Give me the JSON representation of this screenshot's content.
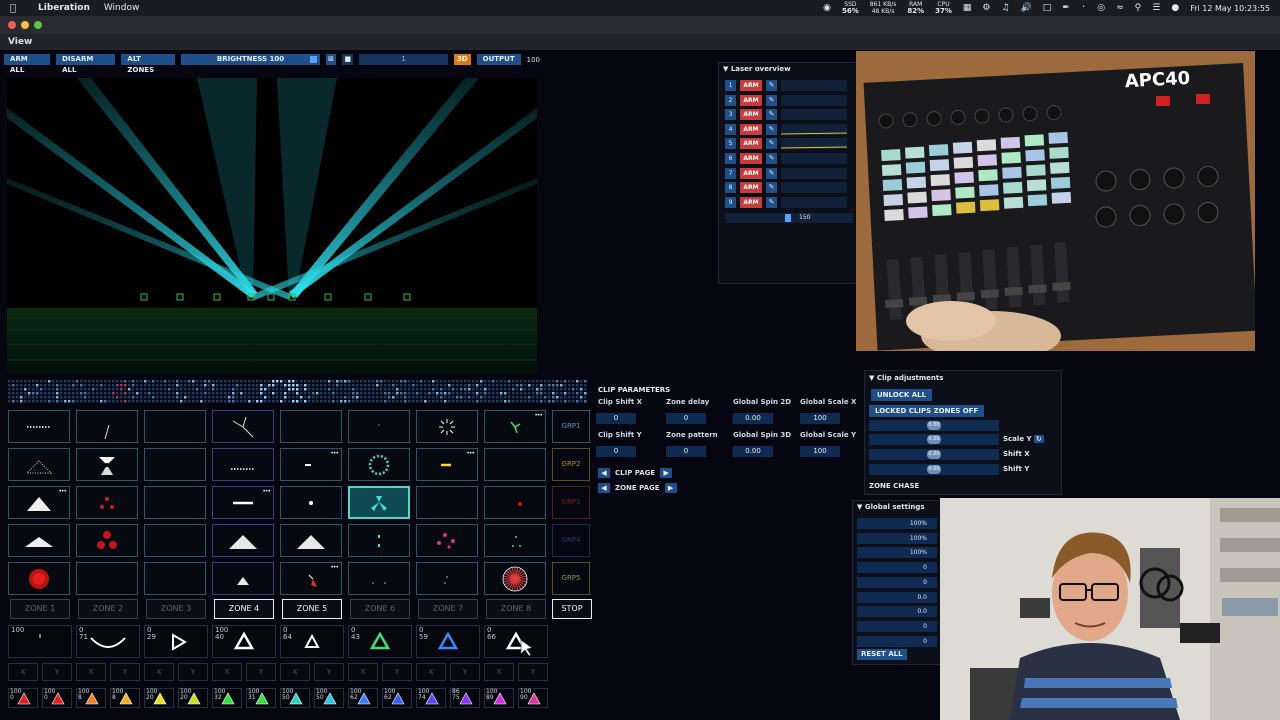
{
  "menubar": {
    "app": "Liberation",
    "menu_window": "Window",
    "disk_label": "SSD",
    "disk_value": "56%",
    "net_up": "861 KB/s",
    "net_down": "48 KB/s",
    "ram_label": "RAM",
    "ram_value": "82%",
    "cpu_label": "CPU",
    "cpu_value": "37%",
    "datetime": "Fri 12 May  10:23:55"
  },
  "window": {
    "view_label": "View"
  },
  "toolbar": {
    "arm_all": "ARM ALL",
    "disarm_all": "DISARM ALL",
    "alt_zones": "ALT ZONES",
    "brightness": "BRIGHTNESS 100",
    "zoom_value": "1",
    "btn_3d": "3D",
    "output": "OUTPUT",
    "output_value": "100"
  },
  "clip_grid": {
    "groups": [
      "GRP1",
      "GRP2",
      "GRP3",
      "GRP4",
      "GRP5"
    ],
    "zones": [
      "ZONE 1",
      "ZONE 2",
      "ZONE 3",
      "ZONE 4",
      "ZONE 5",
      "ZONE 6",
      "ZONE 7",
      "ZONE 8"
    ],
    "stop": "STOP"
  },
  "fx_row": {
    "values": [
      [
        "100",
        ""
      ],
      [
        "0",
        "71"
      ],
      [
        "0",
        "29"
      ],
      [
        "100",
        "40"
      ],
      [
        "0",
        "64"
      ],
      [
        "0",
        "43"
      ],
      [
        "0",
        "59"
      ],
      [
        "0",
        "66"
      ]
    ]
  },
  "xy_labels": [
    "X",
    "Y"
  ],
  "mini_row": {
    "values": [
      [
        "100",
        "0"
      ],
      [
        "100",
        "0"
      ],
      [
        "100",
        "8"
      ],
      [
        "100",
        "8"
      ],
      [
        "100",
        "20"
      ],
      [
        "100",
        "20"
      ],
      [
        "100",
        "32"
      ],
      [
        "100",
        "31"
      ],
      [
        "100",
        "50"
      ],
      [
        "100",
        "50"
      ],
      [
        "100",
        "62"
      ],
      [
        "100",
        "62"
      ],
      [
        "100",
        "74"
      ],
      [
        "86",
        "75"
      ],
      [
        "100",
        "89"
      ],
      [
        "100",
        "90"
      ]
    ]
  },
  "clip_params": {
    "title": "CLIP PARAMETERS",
    "fields": [
      {
        "label": "Clip Shift X",
        "value": "0"
      },
      {
        "label": "Zone delay",
        "value": "0"
      },
      {
        "label": "Global Spin 2D",
        "value": "0.00"
      },
      {
        "label": "Global Scale X",
        "value": "100"
      },
      {
        "label": "Clip Shift Y",
        "value": "0"
      },
      {
        "label": "Zone pattern",
        "value": "0"
      },
      {
        "label": "Global Spin 3D",
        "value": "0.00"
      },
      {
        "label": "Global Scale Y",
        "value": "100"
      }
    ],
    "clip_page": "CLIP PAGE",
    "zone_page": "ZONE PAGE"
  },
  "laser_overview": {
    "title": "Laser overview",
    "arm": "ARM",
    "numbers": [
      "1",
      "2",
      "3",
      "4",
      "5",
      "6",
      "7",
      "8",
      "9"
    ],
    "slider_value": "150"
  },
  "clip_adjustments": {
    "title": "Clip adjustments",
    "unlock_all": "UNLOCK ALL",
    "locked_clips": "LOCKED CLIPS ZONES OFF",
    "slider_values": [
      "0.00",
      "0.00",
      "0.00",
      "0.00"
    ],
    "scale_y": "Scale Y",
    "shift_x": "Shift X",
    "shift_y": "Shift Y",
    "zone_chase": "ZONE CHASE"
  },
  "global_settings": {
    "title": "Global settings",
    "values": [
      "100%",
      "100%",
      "100%",
      "0",
      "0",
      "0.0",
      "0.0",
      "0",
      "0"
    ],
    "reset_all": "RESET ALL"
  },
  "colors": {
    "accent_blue": "#1f4f88",
    "arm_red": "#c93a3a",
    "laser_cyan": "#2fd9e6",
    "active_cell": "#59d3c9",
    "orange": "#e07a10"
  },
  "hardware": {
    "model": "APC40"
  }
}
